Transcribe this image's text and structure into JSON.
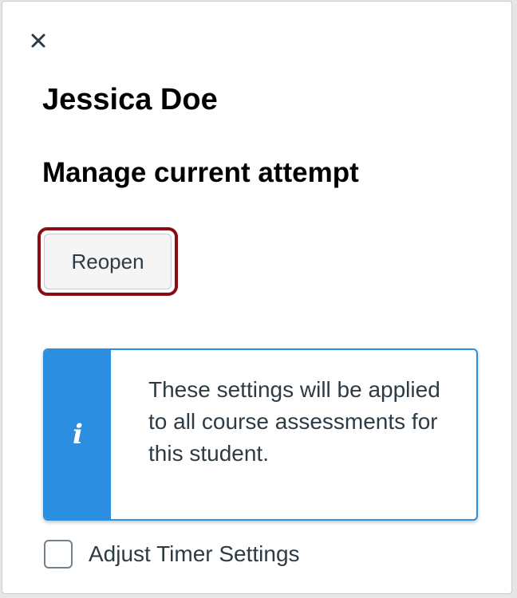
{
  "header": {
    "close_icon": "close-icon"
  },
  "student": {
    "name": "Jessica Doe"
  },
  "attempt": {
    "heading": "Manage current attempt",
    "reopen_label": "Reopen"
  },
  "alert": {
    "icon": "info-icon",
    "icon_glyph": "i",
    "message": "These settings will be applied to all course assessments for this student.",
    "accent_color": "#2b8ee0"
  },
  "timer": {
    "label": "Adjust Timer Settings",
    "checked": false
  },
  "colors": {
    "highlight_outline": "#8b0c12",
    "text": "#2d3b45"
  }
}
